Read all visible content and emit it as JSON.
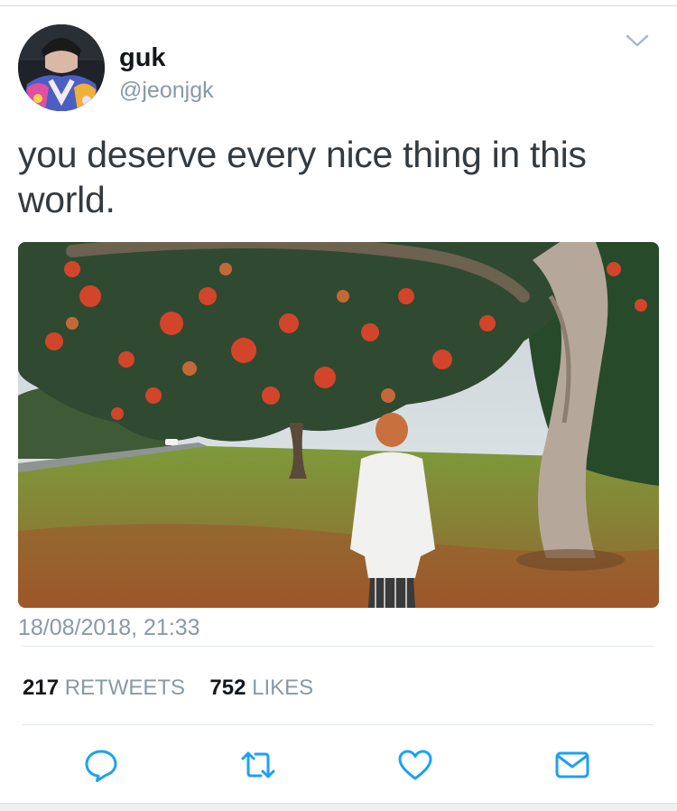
{
  "tweet": {
    "display_name": "guk",
    "handle": "@jeonjgk",
    "text": "you deserve every nice thing in this world.",
    "timestamp": "18/08/2018, 21:33",
    "retweet_count": "217",
    "retweet_label": "RETWEETS",
    "like_count": "752",
    "like_label": "LIKES"
  },
  "icons": {
    "menu": "chevron-down-icon",
    "reply": "reply-icon",
    "retweet": "retweet-icon",
    "like": "heart-icon",
    "message": "envelope-icon"
  },
  "colors": {
    "secondary_text": "#8899a6",
    "primary_text": "#14171a",
    "icon": "#1da1f2"
  }
}
